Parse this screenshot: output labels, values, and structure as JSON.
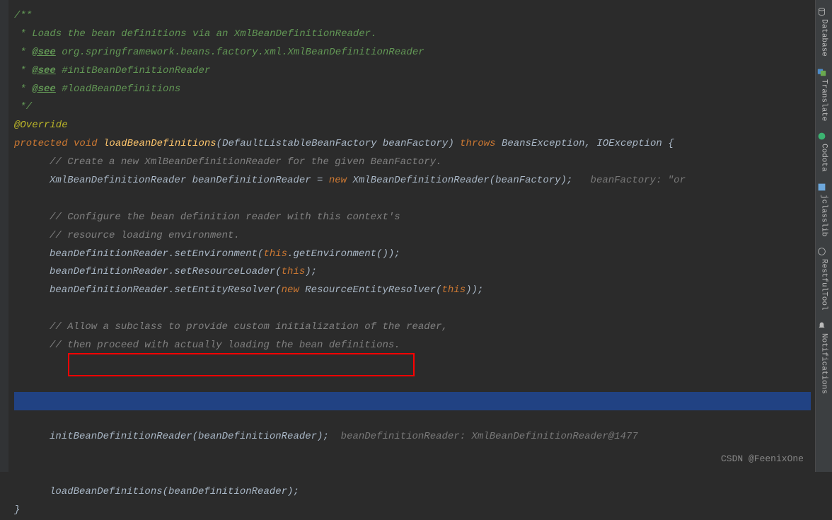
{
  "doc": {
    "start": "/**",
    "l1": " * Loads the bean definitions via an XmlBeanDefinitionReader.",
    "see": "@see",
    "see1": " org.springframework.beans.factory.xml.XmlBeanDefinitionReader",
    "see2": " #initBeanDefinitionReader",
    "see3": " #loadBeanDefinitions",
    "end": " */"
  },
  "ann": "@Override",
  "sig": {
    "protected": "protected ",
    "void": "void ",
    "method": "loadBeanDefinitions",
    "params": "(DefaultListableBeanFactory beanFactory) ",
    "throws": "throws ",
    "exc": "BeansException, IOException {"
  },
  "body": {
    "c1": "// Create a new XmlBeanDefinitionReader for the given BeanFactory.",
    "l1a": "XmlBeanDefinitionReader beanDefinitionReader = ",
    "l1new": "new ",
    "l1b": "XmlBeanDefinitionReader(beanFactory);",
    "l1hint": "   beanFactory: \"or",
    "c2": "// Configure the bean definition reader with this context's",
    "c3": "// resource loading environment.",
    "l2a": "beanDefinitionReader.setEnvironment(",
    "l2this": "this",
    "l2b": ".getEnvironment());",
    "l3a": "beanDefinitionReader.setResourceLoader(",
    "l3this": "this",
    "l3b": ");",
    "l4a": "beanDefinitionReader.setEntityResolver(",
    "l4new": "new ",
    "l4b": "ResourceEntityResolver(",
    "l4this": "this",
    "l4c": "));",
    "c4": "// Allow a subclass to provide custom initialization of the reader,",
    "c5": "// then proceed with actually loading the bean definitions.",
    "l5": "initBeanDefinitionReader(beanDefinitionReader);",
    "l5hint": "  beanDefinitionReader: XmlBeanDefinitionReader@1477",
    "l6": "loadBeanDefinitions(beanDefinitionReader);"
  },
  "close": "}",
  "sidebar": {
    "database": "Database",
    "translate": "Translate",
    "codota": "Codota",
    "jclasslib": "jclasslib",
    "restfultool": "RestfulTool",
    "notifications": "Notifications"
  },
  "watermark": "CSDN @FeenixOne"
}
